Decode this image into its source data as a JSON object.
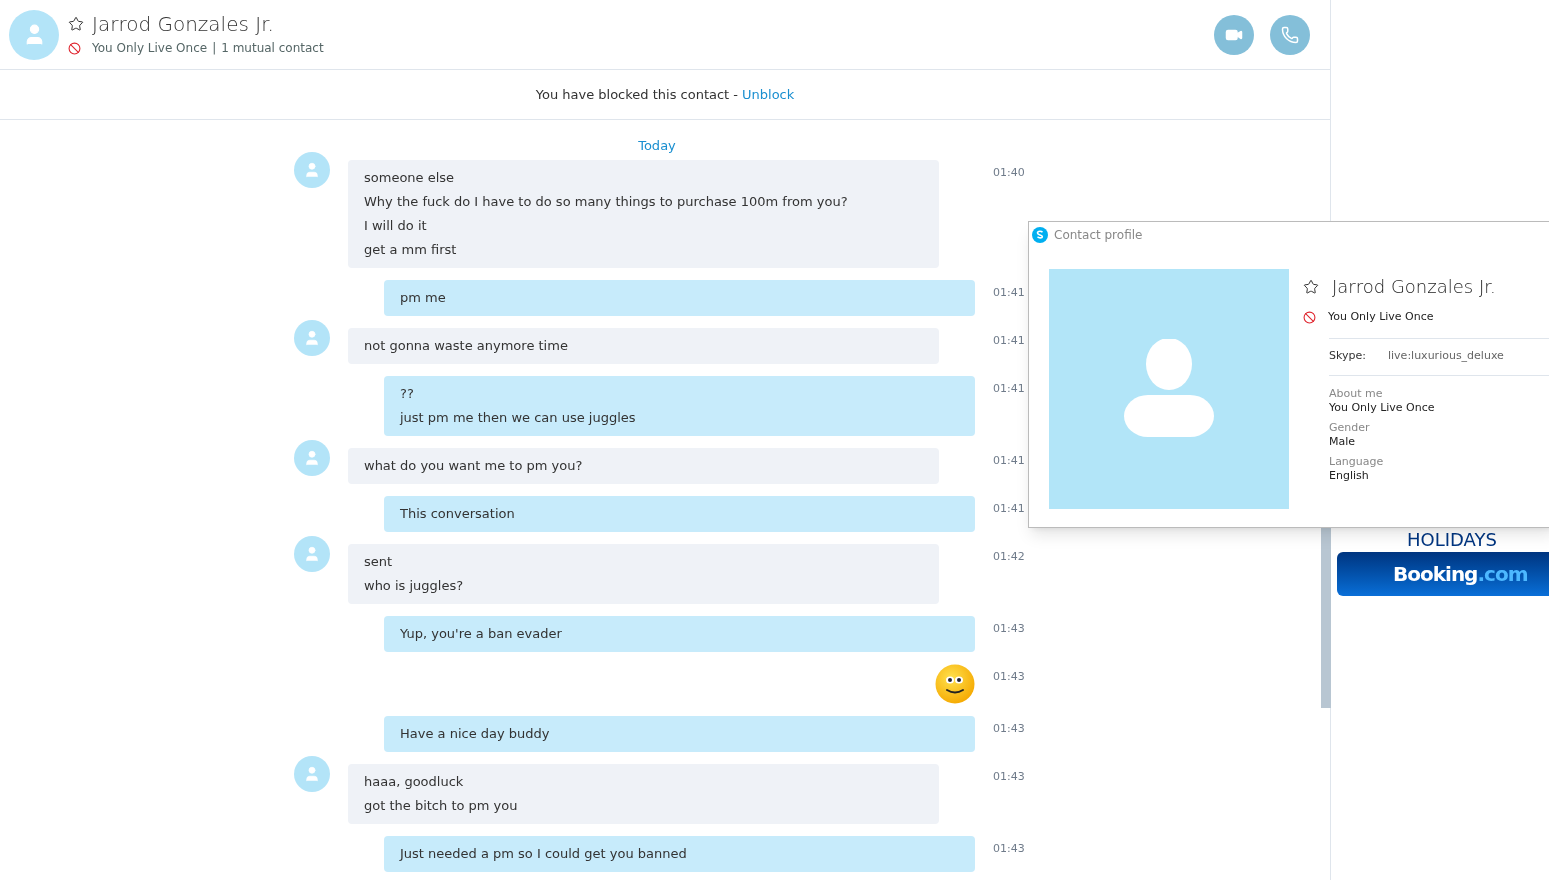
{
  "header": {
    "name": "Jarrod Gonzales Jr.",
    "mood": "You Only Live Once",
    "separator": "|",
    "mutual": "1 mutual contact"
  },
  "blocked_banner": {
    "text": "You have blocked this contact -",
    "link": "Unblock"
  },
  "day_label": "Today",
  "messages": [
    {
      "kind": "incoming",
      "lines": [
        "someone else",
        "Why the fuck do I have to do so many things to purchase 100m from you?",
        "I will do it",
        "get a mm first"
      ],
      "time": "01:40"
    },
    {
      "kind": "outgoing",
      "lines": [
        "pm me"
      ],
      "time": "01:41"
    },
    {
      "kind": "incoming",
      "lines": [
        "not gonna waste anymore time"
      ],
      "time": "01:41"
    },
    {
      "kind": "outgoing",
      "lines": [
        "??",
        "just pm me then we can use juggles"
      ],
      "time": "01:41"
    },
    {
      "kind": "incoming",
      "lines": [
        "what do you want me to pm you?"
      ],
      "time": "01:41"
    },
    {
      "kind": "outgoing",
      "lines": [
        "This conversation"
      ],
      "time": "01:41"
    },
    {
      "kind": "incoming",
      "lines": [
        "sent",
        "who is juggles?"
      ],
      "time": "01:42"
    },
    {
      "kind": "outgoing",
      "lines": [
        "Yup, you're a ban evader"
      ],
      "time": "01:43"
    },
    {
      "kind": "emoji",
      "time": "01:43"
    },
    {
      "kind": "outgoing",
      "lines": [
        "Have a nice day buddy"
      ],
      "time": "01:43"
    },
    {
      "kind": "incoming",
      "lines": [
        "haaa, goodluck",
        "got the bitch to pm you"
      ],
      "time": "01:43"
    },
    {
      "kind": "outgoing",
      "lines": [
        "Just needed a pm so I could get you banned"
      ],
      "time": "01:43"
    }
  ],
  "ad": {
    "heading": "HOLIDAYS",
    "brand": "Booking",
    "suffix": ".com"
  },
  "profile_popup": {
    "title": "Contact profile",
    "name": "Jarrod Gonzales Jr.",
    "mood": "You Only Live Once",
    "skype_label": "Skype:",
    "skype_value": "live:luxurious_deluxe",
    "fields": [
      {
        "label": "About me",
        "value": "You Only Live Once"
      },
      {
        "label": "Gender",
        "value": "Male"
      },
      {
        "label": "Language",
        "value": "English"
      }
    ]
  }
}
